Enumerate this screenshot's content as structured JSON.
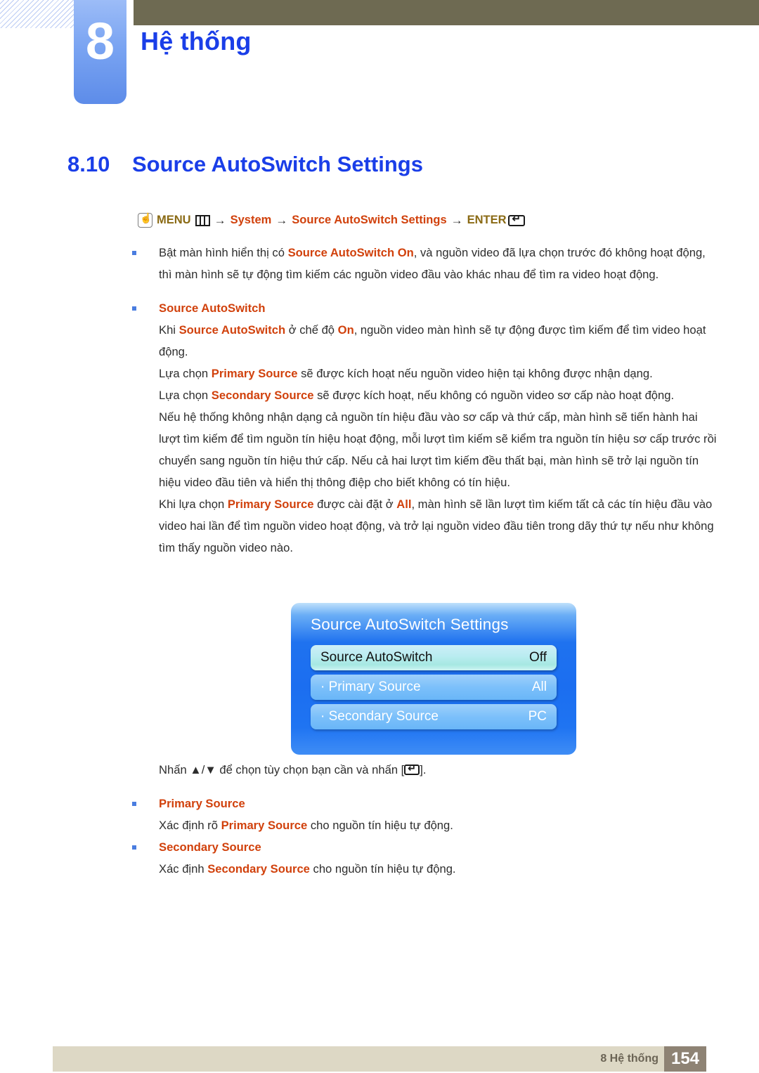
{
  "header": {
    "chapter_number": "8",
    "chapter_title": "Hệ thống"
  },
  "section": {
    "number": "8.10",
    "title": "Source AutoSwitch Settings"
  },
  "menu_path": {
    "hand_icon": "hand-press-icon",
    "menu_label": "MENU",
    "bars_icon": "menu-bars-icon",
    "arrow1": "→",
    "system_label": "System",
    "arrow2": "→",
    "settings_label": "Source AutoSwitch Settings",
    "arrow3": "→",
    "enter_label": "ENTER",
    "enter_icon": "enter-key-icon"
  },
  "body": {
    "b1_pre": "Bật màn hình hiển thị có ",
    "b1_hl": "Source AutoSwitch On",
    "b1_post": ", và nguồn video đã lựa chọn trước đó không hoạt động, thì màn hình sẽ tự động tìm kiếm các nguồn video đầu vào khác nhau để tìm ra video hoạt động.",
    "b2_head": "Source AutoSwitch",
    "p1_a": "Khi ",
    "p1_hl1": "Source AutoSwitch",
    "p1_b": " ở chế độ ",
    "p1_hl2": "On",
    "p1_c": ", nguồn video màn hình sẽ tự động được tìm kiếm để tìm video hoạt động.",
    "p2_a": "Lựa chọn ",
    "p2_hl": "Primary Source",
    "p2_b": " sẽ được kích hoạt nếu nguồn video hiện tại không được nhận dạng.",
    "p3_a": "Lựa chọn ",
    "p3_hl": "Secondary Source",
    "p3_b": " sẽ được kích hoạt, nếu không có nguồn video sơ cấp nào hoạt động.",
    "p4": "Nếu hệ thống không nhận dạng cả nguồn tín hiệu đầu vào sơ cấp và thứ cấp, màn hình sẽ tiến hành hai lượt tìm kiếm để tìm nguồn tín hiệu hoạt động, mỗi lượt tìm kiếm sẽ kiểm tra nguồn tín hiệu sơ cấp trước rồi chuyển sang nguồn tín hiệu thứ cấp. Nếu cả hai lượt tìm kiếm đều thất bại, màn hình sẽ trở lại nguồn tín hiệu video đầu tiên và hiển thị thông điệp cho biết không có tín hiệu.",
    "p5_a": "Khi lựa chọn ",
    "p5_hl1": "Primary Source",
    "p5_b": " được cài đặt ở ",
    "p5_hl2": "All",
    "p5_c": ", màn hình sẽ lần lượt tìm kiếm tất cả các tín hiệu đầu vào video hai lần để tìm nguồn video hoạt động, và trở lại nguồn video đầu tiên trong dãy thứ tự nếu như không tìm thấy nguồn video nào."
  },
  "osd": {
    "title": "Source AutoSwitch Settings",
    "rows": [
      {
        "label": "Source AutoSwitch",
        "value": "Off",
        "selected": true
      },
      {
        "label": "· Primary Source",
        "value": "All",
        "selected": false
      },
      {
        "label": "· Secondary Source",
        "value": "PC",
        "selected": false
      }
    ]
  },
  "after_osd": {
    "hint_a": "Nhấn ▲/▼ để chọn tùy chọn bạn cần và nhấn [",
    "hint_b": "].",
    "b3_head": "Primary Source",
    "p6_a": "Xác định rõ ",
    "p6_hl": "Primary Source",
    "p6_b": " cho nguồn tín hiệu tự động.",
    "b4_head": "Secondary Source",
    "p7_a": "Xác định ",
    "p7_hl": "Secondary Source",
    "p7_b": " cho nguồn tín hiệu tự động."
  },
  "footer": {
    "label": "8 Hệ thống",
    "page_number": "154"
  },
  "colors": {
    "accent_blue": "#1a3ee8",
    "highlight_red": "#d1410c",
    "gold": "#8a6a14",
    "olive_bar": "#6e6a52",
    "tab_blue": "#7aa4f2",
    "footer_bg": "#ddd8c5",
    "page_box": "#8e8374"
  }
}
